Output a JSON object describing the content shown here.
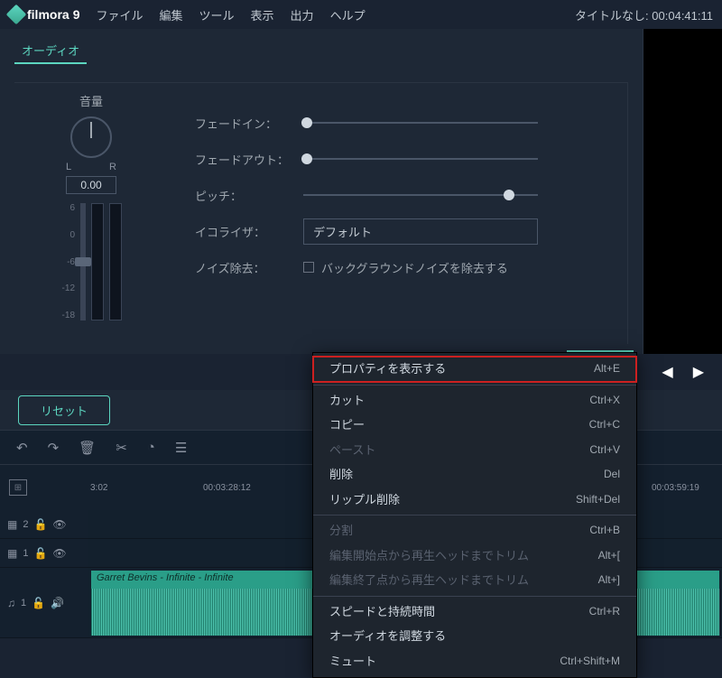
{
  "app": {
    "name": "filmora",
    "version": "9"
  },
  "menubar": {
    "items": [
      "ファイル",
      "編集",
      "ツール",
      "表示",
      "出力",
      "ヘルプ"
    ],
    "title_prefix": "タイトルなし:",
    "timecode": "00:04:41:11"
  },
  "audio_panel": {
    "tab": "オーディオ",
    "volume": {
      "label": "音量",
      "L": "L",
      "R": "R",
      "value": "0.00",
      "scale": [
        "6",
        "0",
        "-6",
        "-12",
        "-18"
      ]
    },
    "props": {
      "fade_in": "フェードイン：",
      "fade_out": "フェードアウト：",
      "pitch": "ピッチ：",
      "equalizer": "イコライザ：",
      "eq_value": "デフォルト",
      "denoise": "ノイズ除去：",
      "denoise_chk": "バックグラウンドノイズを除去する"
    }
  },
  "reset": {
    "label": "リセット"
  },
  "ruler": {
    "t1": "3:02",
    "t2": "00:03:28:12",
    "t3": "00:03:59:19"
  },
  "tracks": {
    "t2": "2",
    "t1": "1",
    "a1": "1"
  },
  "clip": {
    "label": "Garret Bevins - Infinite - Infinite"
  },
  "context_menu": {
    "items": [
      {
        "label": "プロパティを表示する",
        "shortcut": "Alt+E",
        "enabled": true,
        "highlighted": true
      },
      {
        "sep": true
      },
      {
        "label": "カット",
        "shortcut": "Ctrl+X",
        "enabled": true
      },
      {
        "label": "コピー",
        "shortcut": "Ctrl+C",
        "enabled": true
      },
      {
        "label": "ペースト",
        "shortcut": "Ctrl+V",
        "enabled": false
      },
      {
        "label": "削除",
        "shortcut": "Del",
        "enabled": true
      },
      {
        "label": "リップル削除",
        "shortcut": "Shift+Del",
        "enabled": true
      },
      {
        "sep": true
      },
      {
        "label": "分割",
        "shortcut": "Ctrl+B",
        "enabled": false
      },
      {
        "label": "編集開始点から再生ヘッドまでトリム",
        "shortcut": "Alt+[",
        "enabled": false
      },
      {
        "label": "編集終了点から再生ヘッドまでトリム",
        "shortcut": "Alt+]",
        "enabled": false
      },
      {
        "sep": true
      },
      {
        "label": "スピードと持続時間",
        "shortcut": "Ctrl+R",
        "enabled": true
      },
      {
        "label": "オーディオを調整する",
        "shortcut": "",
        "enabled": true
      },
      {
        "label": "ミュート",
        "shortcut": "Ctrl+Shift+M",
        "enabled": true
      }
    ]
  }
}
